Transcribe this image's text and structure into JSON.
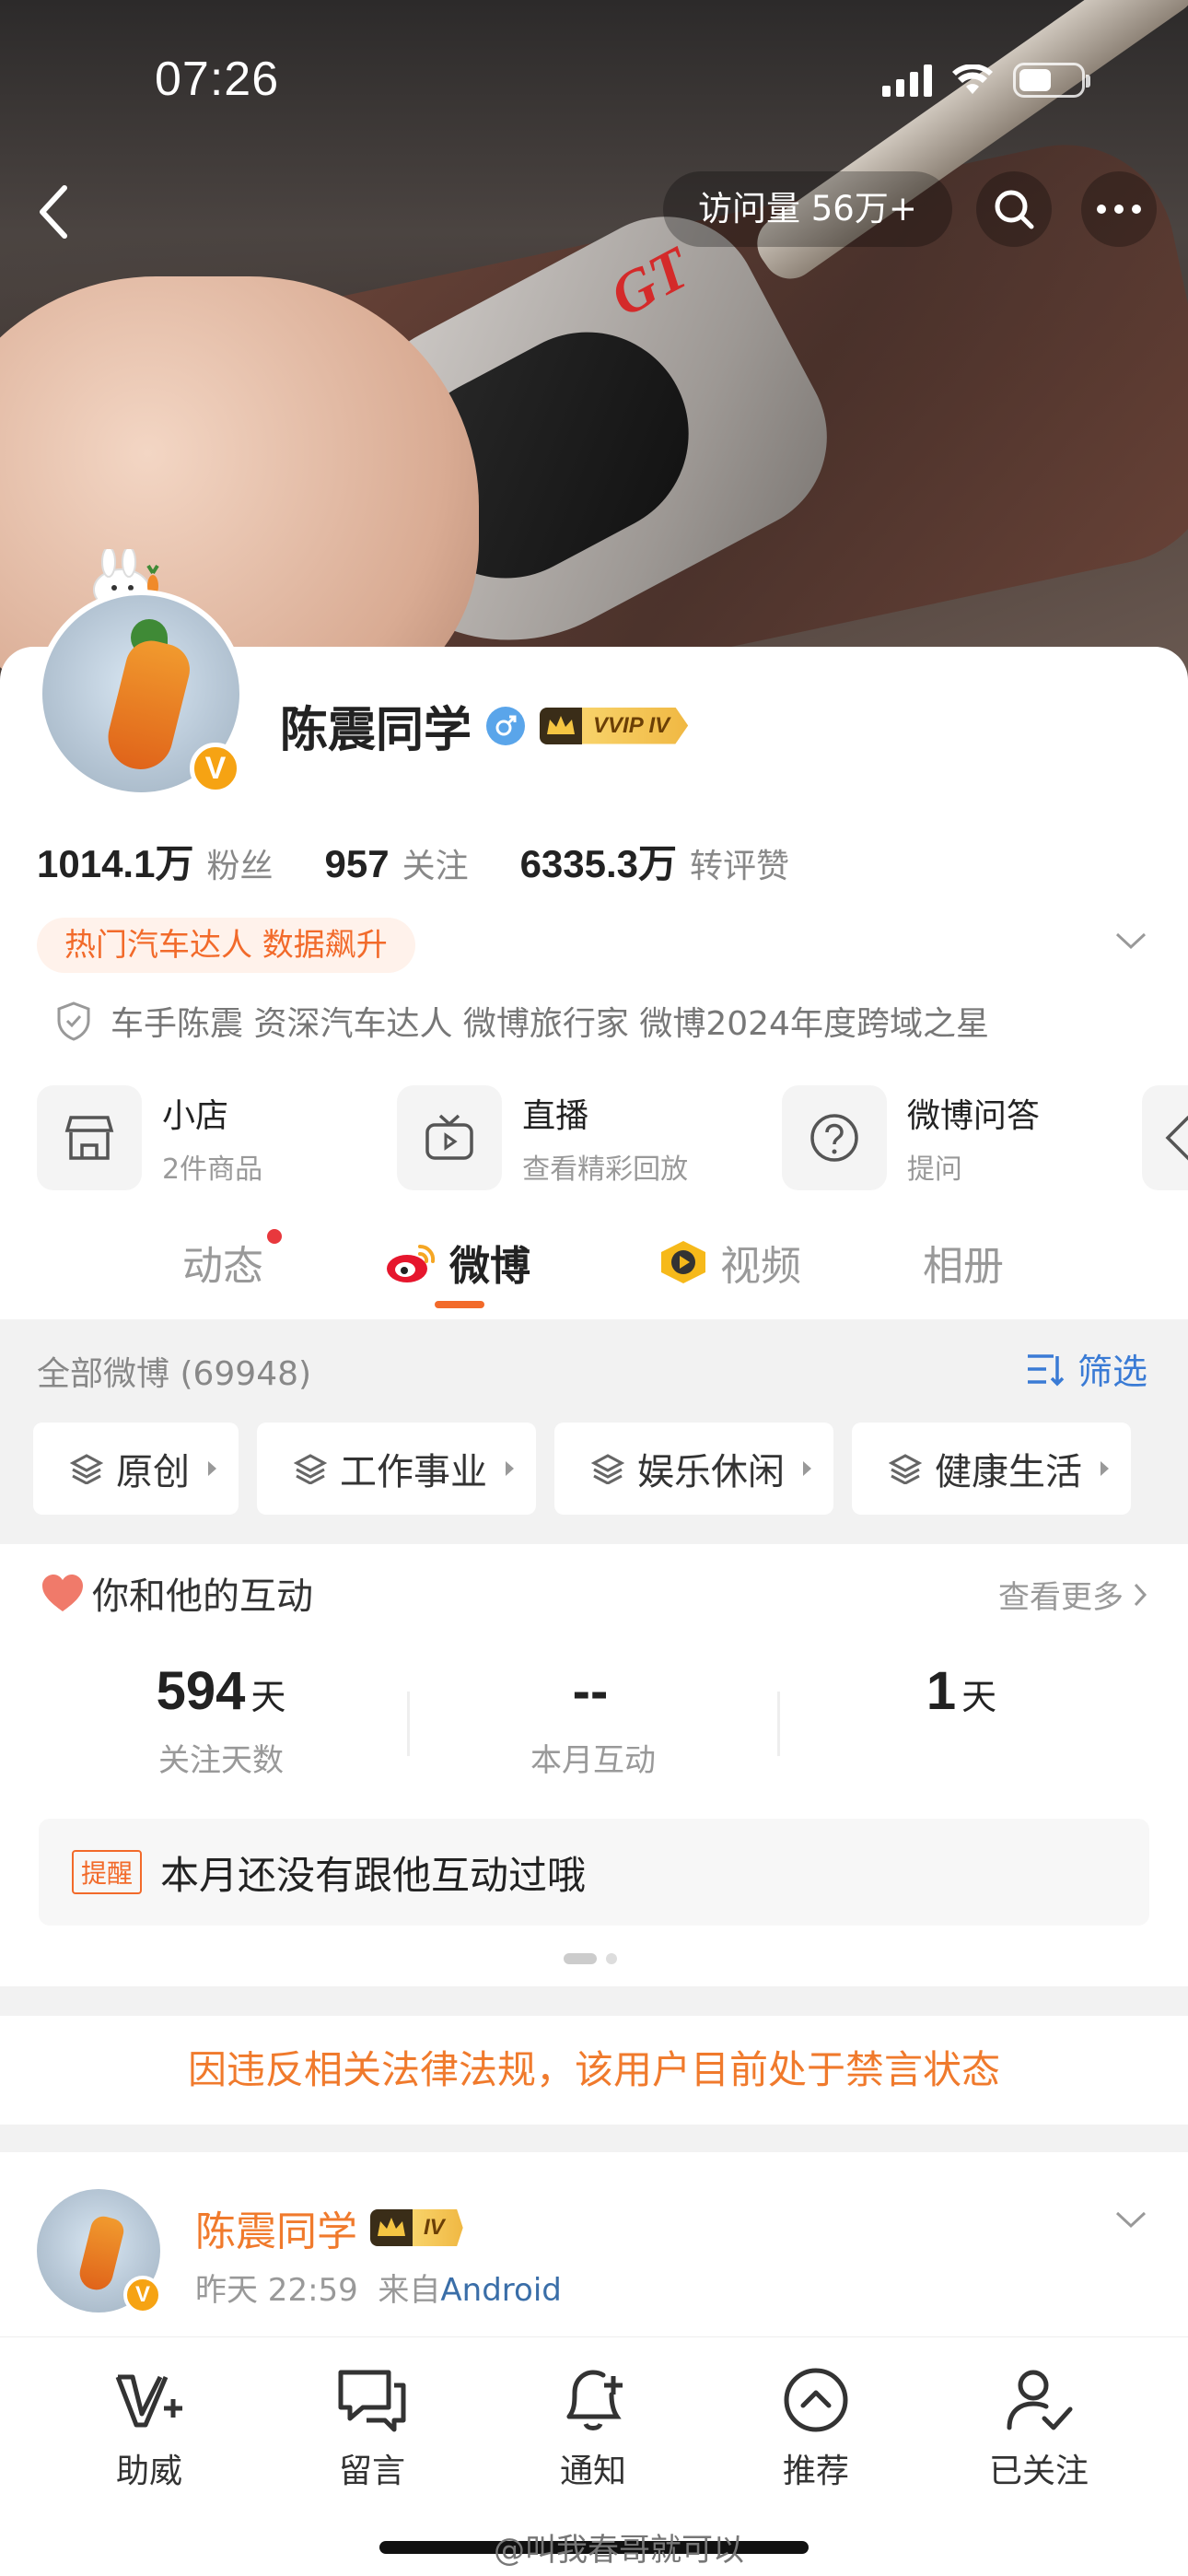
{
  "status_bar": {
    "time": "07:26"
  },
  "nav": {
    "visits": "访问量 56万+"
  },
  "profile": {
    "name": "陈震同学",
    "vip_label": "VVIP IV",
    "stats": [
      {
        "value": "1014.1万",
        "label": "粉丝"
      },
      {
        "value": "957",
        "label": "关注"
      },
      {
        "value": "6335.3万",
        "label": "转评赞"
      }
    ],
    "hot_tag": "热门汽车达人 数据飙升",
    "certification": "车手陈震 资深汽车达人   微博旅行家 微博2024年度跨域之星"
  },
  "services": [
    {
      "title": "小店",
      "sub": "2件商品",
      "icon": "store-icon"
    },
    {
      "title": "直播",
      "sub": "查看精彩回放",
      "icon": "tv-icon"
    },
    {
      "title": "微博问答",
      "sub": "提问",
      "icon": "question-icon"
    }
  ],
  "tabs": [
    {
      "label": "动态",
      "active": false
    },
    {
      "label": "微博",
      "active": true
    },
    {
      "label": "视频",
      "active": false
    },
    {
      "label": "相册",
      "active": false
    }
  ],
  "filter": {
    "title": "全部微博 (69948)",
    "button": "筛选",
    "chips": [
      "原创",
      "工作事业",
      "娱乐休闲",
      "健康生活"
    ]
  },
  "interaction": {
    "title": "你和他的互动",
    "more": "查看更多",
    "stats": [
      {
        "value": "594",
        "unit": "天",
        "label": "关注天数"
      },
      {
        "value": "--",
        "unit": "",
        "label": "本月互动"
      },
      {
        "value": "1",
        "unit": "天",
        "label": ""
      }
    ],
    "remind_tag": "提醒",
    "remind_text": "本月还没有跟他互动过哦"
  },
  "ban_notice": "因违反相关法律法规，该用户目前处于禁言状态",
  "post": {
    "name": "陈震同学",
    "vip_label": "IV",
    "time": "昨天 22:59",
    "from": "来自",
    "source": "Android"
  },
  "toolbar": [
    {
      "label": "助威",
      "icon": "cheer-icon"
    },
    {
      "label": "留言",
      "icon": "message-icon"
    },
    {
      "label": "通知",
      "icon": "bell-icon"
    },
    {
      "label": "推荐",
      "icon": "recommend-icon"
    },
    {
      "label": "已关注",
      "icon": "followed-icon"
    }
  ],
  "watermark": "@叫我春哥就可以",
  "colors": {
    "accent": "#f26a2a",
    "link": "#3a7bd5",
    "ban": "#f07a2c"
  }
}
